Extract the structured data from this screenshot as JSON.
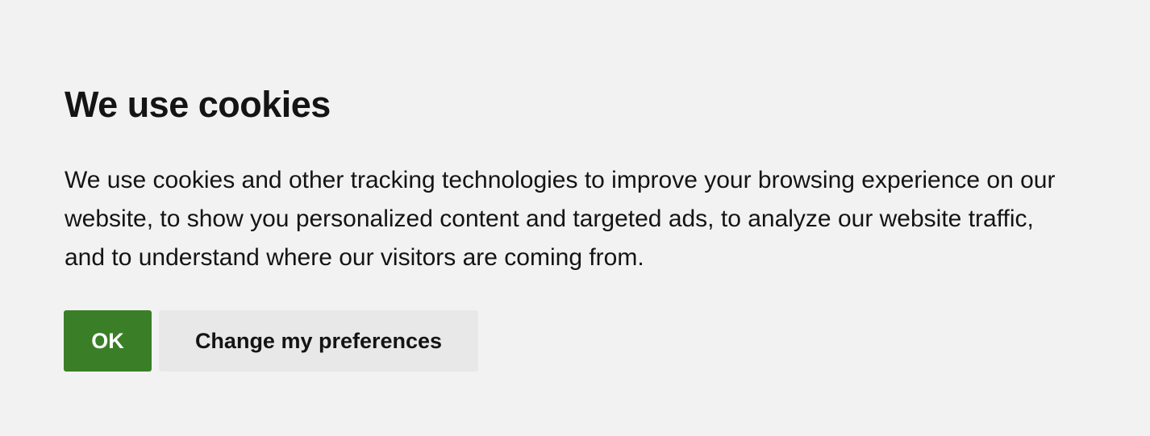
{
  "cookie_banner": {
    "title": "We use cookies",
    "description": "We use cookies and other tracking technologies to improve your browsing experience on our website, to show you personalized content and targeted ads, to analyze our website traffic, and to understand where our visitors are coming from.",
    "buttons": {
      "ok_label": "OK",
      "preferences_label": "Change my preferences"
    }
  },
  "colors": {
    "background": "#f2f2f2",
    "ok_button": "#3a7f27",
    "preferences_button": "#e8e8e8",
    "text": "#141414"
  }
}
